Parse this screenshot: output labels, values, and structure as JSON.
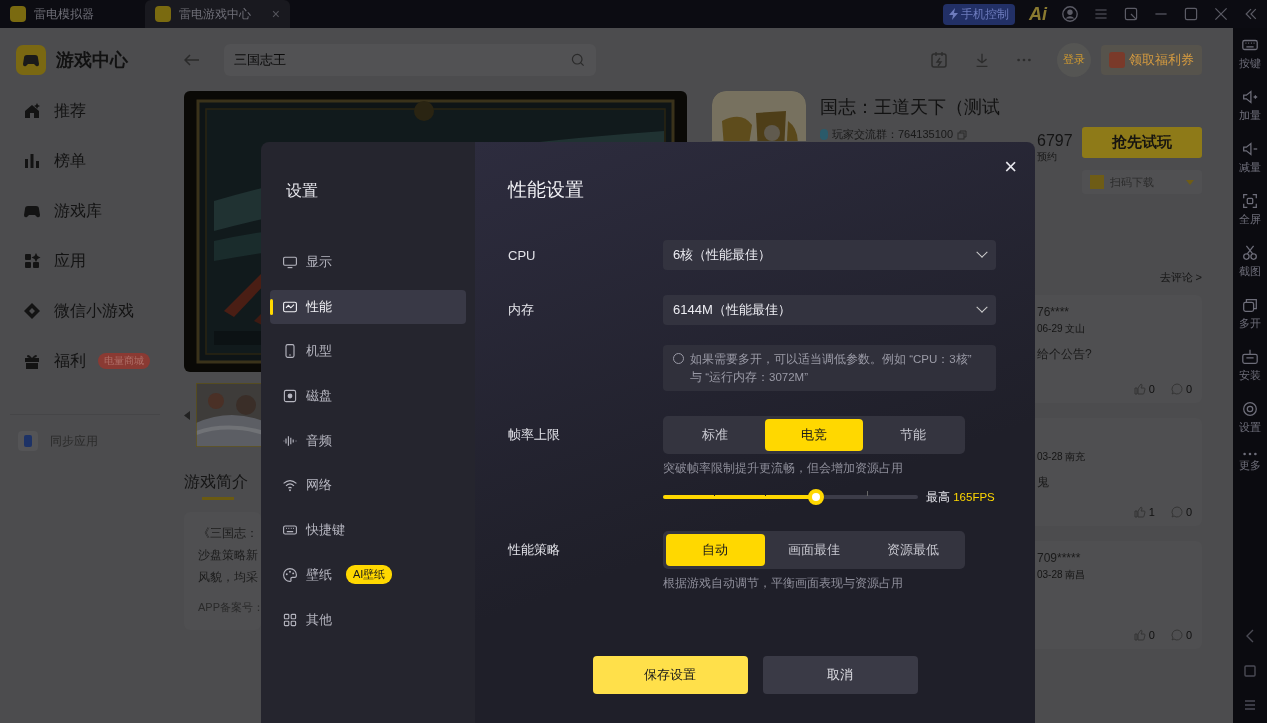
{
  "titlebar": {
    "tabs": [
      {
        "label": "雷电模拟器",
        "selected": false
      },
      {
        "label": "雷电游戏中心",
        "selected": true,
        "close": "×"
      }
    ],
    "phone_control": "手机控制",
    "logo": "Ai"
  },
  "sidebar": {
    "title": "游戏中心",
    "items": [
      {
        "label": "推荐"
      },
      {
        "label": "榜单"
      },
      {
        "label": "游戏库"
      },
      {
        "label": "应用"
      },
      {
        "label": "微信小游戏"
      },
      {
        "label": "福利",
        "badge": "电量商城"
      }
    ],
    "sync": "同步应用"
  },
  "search": {
    "value": "三国志王"
  },
  "login": "登录",
  "coupon": "领取福利券",
  "game": {
    "title": "国志：王道天下（测试",
    "group": "玩家交流群：764135100",
    "count": "6797",
    "count_label": "预约",
    "play": "抢先试玩",
    "scan": "扫码下载"
  },
  "intro": {
    "heading": "游戏简介",
    "lines": [
      "《三国志：",
      "沙盘策略新",
      "风貌，均采"
    ],
    "record": "APP备案号："
  },
  "comments": {
    "link": "去评论 >",
    "items": [
      {
        "user": "76****",
        "meta": "06-29 文山",
        "text": "给个公告?",
        "likes": "0",
        "replies": "0"
      },
      {
        "meta": "03-28 南充",
        "text": "鬼",
        "likes": "1",
        "replies": "0"
      },
      {
        "user": "709*****",
        "meta": "03-28 南昌",
        "likes": "0",
        "replies": "0"
      }
    ]
  },
  "toolbar": [
    {
      "label": "按键"
    },
    {
      "label": "加量"
    },
    {
      "label": "减量"
    },
    {
      "label": "全屏"
    },
    {
      "label": "截图"
    },
    {
      "label": "多开"
    },
    {
      "label": "安装"
    },
    {
      "label": "设置"
    },
    {
      "label": "更多"
    }
  ],
  "settings": {
    "title": "设置",
    "close": "×",
    "nav": [
      {
        "label": "显示",
        "selected": false
      },
      {
        "label": "性能",
        "selected": true
      },
      {
        "label": "机型",
        "selected": false
      },
      {
        "label": "磁盘",
        "selected": false
      },
      {
        "label": "音频",
        "selected": false
      },
      {
        "label": "网络",
        "selected": false
      },
      {
        "label": "快捷键",
        "selected": false
      },
      {
        "label": "壁纸",
        "selected": false,
        "badge": "AI壁纸"
      },
      {
        "label": "其他",
        "selected": false
      }
    ],
    "heading": "性能设置",
    "cpu": {
      "label": "CPU",
      "value": "6核（性能最佳）"
    },
    "memory": {
      "label": "内存",
      "value": "6144M（性能最佳）"
    },
    "note": "如果需要多开，可以适当调低参数。例如 “CPU：3核” 与 “运行内存：3072M”",
    "fps": {
      "label": "帧率上限",
      "options": [
        {
          "label": "标准",
          "selected": false
        },
        {
          "label": "电竞",
          "selected": true
        },
        {
          "label": "节能",
          "selected": false
        }
      ],
      "hint": "突破帧率限制提升更流畅，但会增加资源占用",
      "level": 0.6,
      "max_label": "最高",
      "max_value": "165FPS"
    },
    "strategy": {
      "label": "性能策略",
      "options": [
        {
          "label": "自动",
          "selected": true
        },
        {
          "label": "画面最佳",
          "selected": false
        },
        {
          "label": "资源最低",
          "selected": false
        }
      ],
      "hint": "根据游戏自动调节，平衡画面表现与资源占用"
    },
    "buttons": [
      {
        "label": "保存设置",
        "kind": "primary"
      },
      {
        "label": "取消",
        "kind": "secondary"
      }
    ]
  }
}
